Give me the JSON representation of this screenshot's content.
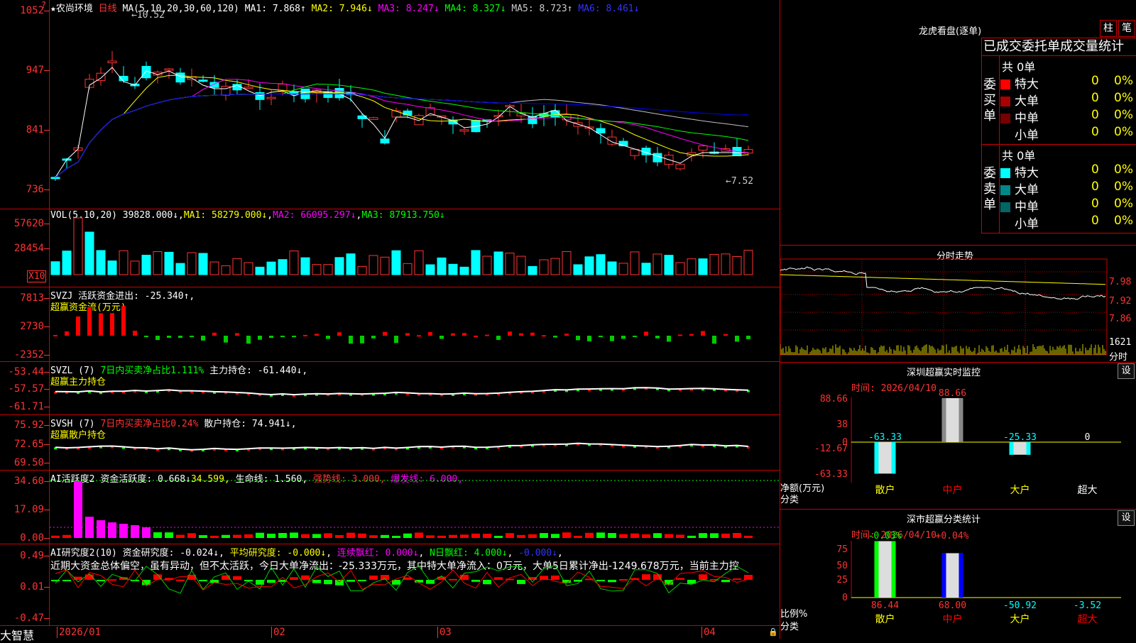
{
  "stock": {
    "name": "农尚环境",
    "period": "日线",
    "star": "★"
  },
  "kline": {
    "ma_params": "MA(5,10,20,30,60,120)",
    "ma1": "MA1: 7.868↑",
    "ma2": "MA2: 7.946↓",
    "ma3": "MA3: 8.247↓",
    "ma4": "MA4: 8.327↓",
    "ma5": "MA5: 8.723↑",
    "ma6": "MA6: 8.461↓",
    "y_ticks": [
      "1052",
      "947",
      "841",
      "736"
    ],
    "high_mark": "10.52",
    "low_mark": "7.52",
    "colors": {
      "up": "#ff3333",
      "down": "#00ffff",
      "ma1": "#ffffff",
      "ma2": "#ffff00",
      "ma3": "#ff00ff",
      "ma4": "#00ff00",
      "ma5": "#c0c0c0",
      "ma6": "#0000ff"
    }
  },
  "vol": {
    "label": "VOL(5,10,20)",
    "value": "39828.000↓",
    "ma1": "MA1: 58279.000↓",
    "ma2": "MA2: 66095.297↓",
    "ma3": "MA3: 87913.750↓",
    "y_ticks": [
      "57620",
      "28454"
    ],
    "unit": "X10"
  },
  "svzj": {
    "label": "SVZJ",
    "desc": "活跃资金进出: -25.340↑,",
    "sub": "超赢资金流(万元)",
    "y_ticks": [
      "7813",
      "2730",
      "-2352"
    ]
  },
  "svzl": {
    "label": "SVZL (7)",
    "desc1": "7日内买卖净占比1.111%",
    "desc2": "主力持仓: -61.440↓,",
    "sub": "超赢主力持仓",
    "y_ticks": [
      "-53.44",
      "-57.57",
      "-61.71"
    ]
  },
  "svsh": {
    "label": "SVSH (7)",
    "desc1": "7日内买卖净占比0.24%",
    "desc2": "散户持仓: 74.941↓,",
    "sub": "超赢散户持仓",
    "y_ticks": [
      "75.92",
      "72.65",
      "69.50"
    ]
  },
  "ai1": {
    "label": "AI活跃度2",
    "d1": "资金活跃度: 0.668↓",
    "d2": "34.599,",
    "d3": "生命线: 1.560,",
    "d4": "强势线: 3.000,",
    "d5": "爆发线: 6.000,",
    "y_ticks": [
      "34.60",
      "17.09",
      "0.00"
    ]
  },
  "ai2": {
    "label": "AI研究度2(10)",
    "d1": "资金研究度: -0.024↓",
    "d2": "平均研究度: -0.000↓",
    "d3": "连续飘红: 0.000↓",
    "d4": "N日飘红: 4.000↓",
    "d5": "-0.000↓",
    "text": "近期大资金总体偏空，虽有异动，但不太活跃，今日大单净流出：-25.333万元，其中特大单净流入：0万元，大单5日累计净出-1249.678万元，当前主力控",
    "y_ticks": [
      "0.49",
      "0.01",
      "-0.47"
    ]
  },
  "xaxis": {
    "labels": [
      "2026/01",
      "02",
      "03",
      "04"
    ],
    "brand": "大智慧"
  },
  "dragon": {
    "title": "龙虎看盘(逐单)",
    "btn1": "柱",
    "btn2": "笔",
    "header": "已成交委托单成交量统计",
    "buy": {
      "side": "委买单",
      "total": "共 0单",
      "rows": [
        {
          "name": "特大",
          "val": "0",
          "pct": "0%",
          "color": "#ff0000"
        },
        {
          "name": "大单",
          "val": "0",
          "pct": "0%",
          "color": "#aa0000"
        },
        {
          "name": "中单",
          "val": "0",
          "pct": "0%",
          "color": "#770000"
        },
        {
          "name": "小单",
          "val": "0",
          "pct": "0%",
          "color": ""
        }
      ]
    },
    "sell": {
      "side": "委卖单",
      "total": "共 0单",
      "rows": [
        {
          "name": "特大",
          "val": "0",
          "pct": "0%",
          "color": "#00ffff"
        },
        {
          "name": "大单",
          "val": "0",
          "pct": "0%",
          "color": "#008888"
        },
        {
          "name": "中单",
          "val": "0",
          "pct": "0%",
          "color": "#006666"
        },
        {
          "name": "小单",
          "val": "0",
          "pct": "0%",
          "color": ""
        }
      ]
    }
  },
  "intraday": {
    "title": "分时走势",
    "prices": [
      "7.98",
      "7.92",
      "7.86"
    ],
    "vol": "1621",
    "vol_unit": "分时"
  },
  "monitor": {
    "title": "深圳超赢实时监控",
    "btn": "设",
    "time": "时间: 2026/04/10",
    "ylabels": [
      "88.66",
      "38",
      "0",
      "-12.67",
      "-63.33"
    ],
    "yunit": "净额(万元)",
    "xunit": "分类",
    "bars": [
      {
        "cat": "散户",
        "value": -63.33,
        "label": "-63.33",
        "catcolor": "#ffff00"
      },
      {
        "cat": "中户",
        "value": 88.66,
        "label": "88.66",
        "catcolor": "#ff0000"
      },
      {
        "cat": "大户",
        "value": -25.33,
        "label": "-25.33",
        "catcolor": "#ffff00"
      },
      {
        "cat": "超大",
        "value": 0,
        "label": "0",
        "catcolor": "#ffffff"
      }
    ]
  },
  "classify": {
    "title": "深市超赢分类统计",
    "btn": "设",
    "time": "时间: 2026/04/10",
    "ylabels": [
      "75",
      "50",
      "25",
      "0"
    ],
    "yunit": "比例%",
    "xunit": "分类",
    "top": [
      "-0.03%",
      "+0.04%"
    ],
    "bars": [
      {
        "cat": "散户",
        "value": 86.44,
        "label": "86.44",
        "color": "#00ff00",
        "catcolor": "#ffff00"
      },
      {
        "cat": "中户",
        "value": 68.0,
        "label": "68.00",
        "color": "#0000ff",
        "catcolor": "#ff0000"
      },
      {
        "cat": "大户",
        "value": -50.92,
        "label": "-50.92",
        "color": "",
        "catcolor": "#ffff00"
      },
      {
        "cat": "超大",
        "value": -3.52,
        "label": "-3.52",
        "color": "",
        "catcolor": "#ff0000"
      }
    ]
  }
}
